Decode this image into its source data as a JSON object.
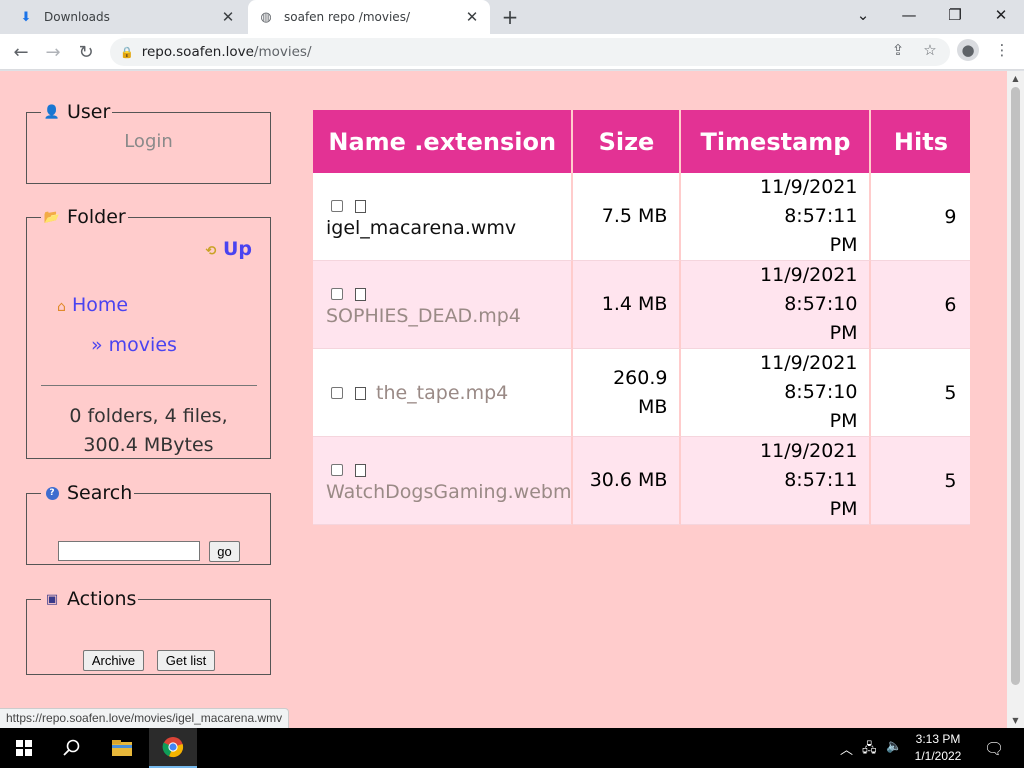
{
  "browser": {
    "tabs": [
      {
        "title": "Downloads",
        "active": false
      },
      {
        "title": "soafen repo /movies/",
        "active": true
      }
    ],
    "url_host": "repo.soafen.love",
    "url_path": "/movies/",
    "status_url": "https://repo.soafen.love/movies/igel_macarena.wmv"
  },
  "sidebar": {
    "user": {
      "legend": "User",
      "login": "Login"
    },
    "folder": {
      "legend": "Folder",
      "up": "Up",
      "home": "Home",
      "current": "» movies",
      "summary_line1": "0 folders, 4 files,",
      "summary_line2": "300.4 MBytes"
    },
    "search": {
      "legend": "Search",
      "button": "go",
      "value": ""
    },
    "actions": {
      "legend": "Actions",
      "archive": "Archive",
      "get_list": "Get list"
    }
  },
  "table": {
    "headers": [
      "Name .extension",
      "Size",
      "Timestamp",
      "Hits"
    ],
    "rows": [
      {
        "name": "igel_macarena.wmv",
        "size_1": "7.5 MB",
        "size_2": "",
        "time_1": "11/9/2021 8:57:11",
        "time_2": "PM",
        "hits": "9"
      },
      {
        "name": "SOPHIES_DEAD.mp4",
        "size_1": "1.4 MB",
        "size_2": "",
        "time_1": "11/9/2021 8:57:10",
        "time_2": "PM",
        "hits": "6"
      },
      {
        "name": "the_tape.mp4",
        "size_1": "260.9",
        "size_2": "MB",
        "time_1": "11/9/2021 8:57:10",
        "time_2": "PM",
        "hits": "5"
      },
      {
        "name": "WatchDogsGaming.webm",
        "size_1": "30.6 MB",
        "size_2": "",
        "time_1": "11/9/2021 8:57:11",
        "time_2": "PM",
        "hits": "5"
      }
    ]
  },
  "taskbar": {
    "time": "3:13 PM",
    "date": "1/1/2022"
  },
  "colors": {
    "page_bg": "#ffcccc",
    "header_bg": "#e33294",
    "link": "#4a43f0"
  },
  "icons": [
    "download-icon",
    "globe-icon",
    "lock-icon",
    "share-icon",
    "star-icon",
    "profile-icon",
    "user-icon",
    "folder-icon",
    "up-icon",
    "home-icon",
    "search-icon",
    "save-icon",
    "file-icon",
    "windows-icon",
    "file-explorer-icon",
    "chrome-icon"
  ]
}
